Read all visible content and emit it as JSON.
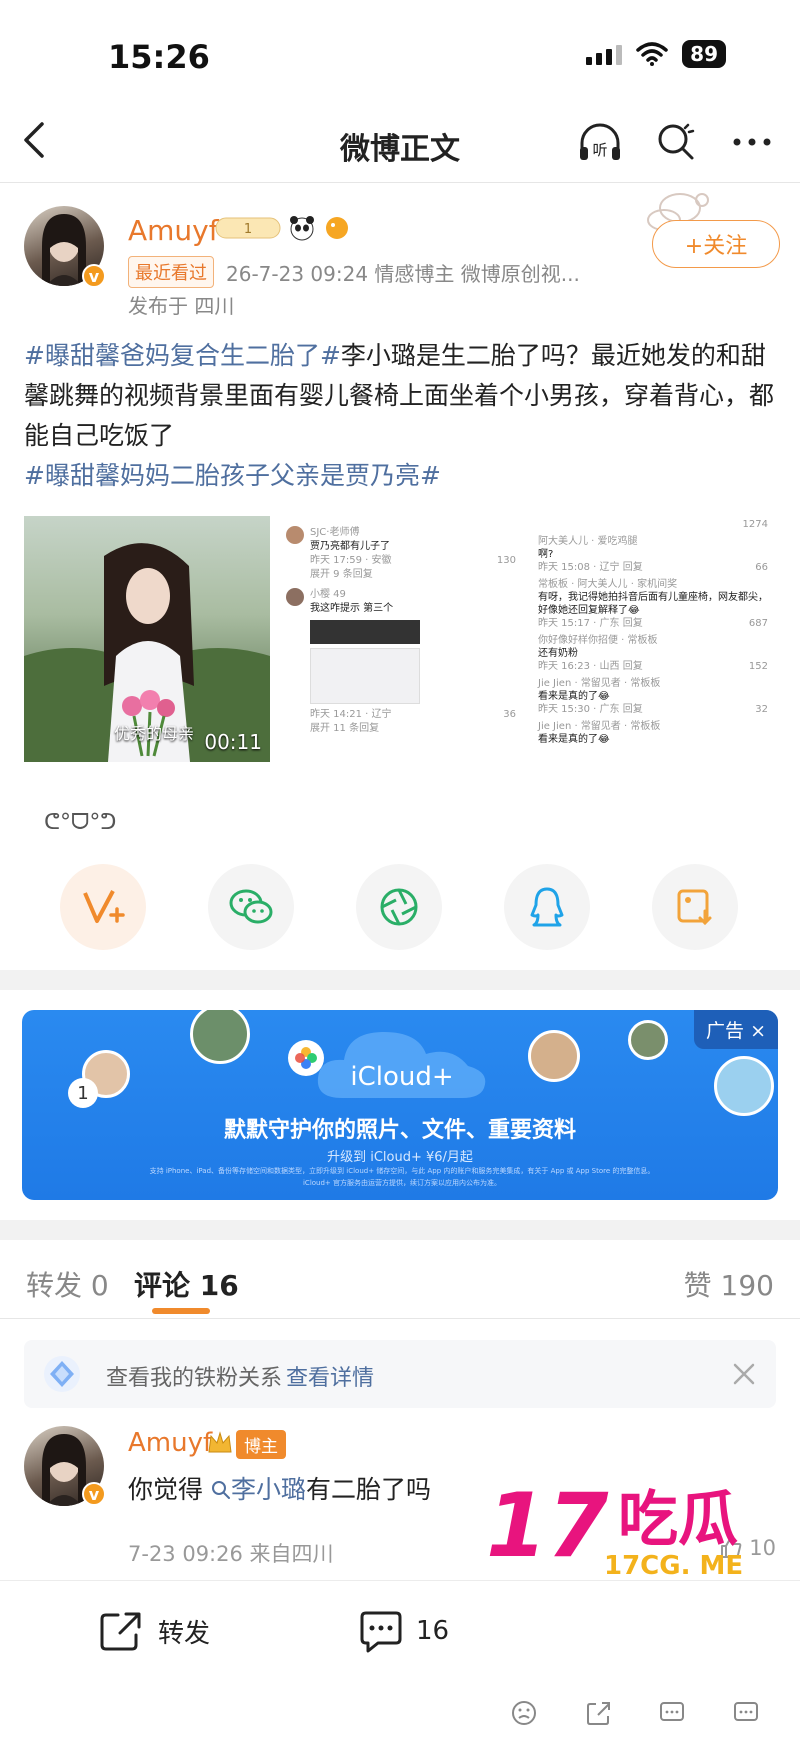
{
  "status_bar": {
    "time": "15:26",
    "battery": "89"
  },
  "nav": {
    "title": "微博正文"
  },
  "author": {
    "name": "Amuyf",
    "recent_tag": "最近看过",
    "meta": "26-7-23 09:24  情感博主  微博原创视...",
    "location": "发布于 四川",
    "follow_label": "+关注"
  },
  "post": {
    "topic1": "#曝甜馨爸妈复合生二胎了#",
    "body": "李小璐是生二胎了吗？最近她发的和甜馨跳舞的视频背景里面有婴儿餐椅上面坐着个小男孩，穿着背心，都能自己吃饭了",
    "topic2": "#曝甜馨妈妈二胎孩子父亲是贾乃亮#"
  },
  "media": {
    "video_caption": "优秀的母亲",
    "video_duration": "00:11",
    "shot1": {
      "rows": [
        {
          "user": "SJC·老师傅",
          "text": "贾乃亮都有儿子了",
          "meta": "昨天 17:59 · 安徽",
          "likes": "130"
        },
        {
          "user": "",
          "text": "展开 9 条回复",
          "meta": "",
          "likes": ""
        },
        {
          "user": "小樱 49",
          "text": "我这咋提示 第三个",
          "meta": "",
          "likes": ""
        },
        {
          "user": "",
          "text": "",
          "meta": "昨天 14:21 · 辽宁",
          "likes": "36"
        },
        {
          "user": "",
          "text": "展开 11 条回复",
          "meta": "",
          "likes": ""
        }
      ]
    },
    "shot2": {
      "rows": [
        {
          "user": "",
          "text": "",
          "meta": "",
          "likes": "1274"
        },
        {
          "user": "阿大美人儿 · 爱吃鸡腿",
          "text": "啊?",
          "meta": "昨天 15:08 · 辽宁  回复",
          "likes": "66"
        },
        {
          "user": "常板板 · 阿大美人儿 · 家机间奖",
          "text": "有呀，我记得她拍抖音后面有儿童座椅，网友都尖，好像她还回复解释了😂",
          "meta": "昨天 15:17 · 广东  回复",
          "likes": "687"
        },
        {
          "user": "你好像好样你招便 · 常板板",
          "text": "还有奶粉",
          "meta": "昨天 16:23 · 山西  回复",
          "likes": "152"
        },
        {
          "user": "Jie Jien · 常留见者 · 常板板",
          "text": "看来是真的了😂",
          "meta": "昨天 15:30 · 广东  回复",
          "likes": "32"
        },
        {
          "user": "Jie Jien · 常留见者 · 常板板",
          "text": "看来是真的了😂",
          "meta": "",
          "likes": ""
        }
      ]
    }
  },
  "emoticon": "ᕦ°ᗜ°ᕤ",
  "share_icons": [
    "v-plus-icon",
    "wechat-icon",
    "moments-icon",
    "qq-icon",
    "save-image-icon"
  ],
  "ad": {
    "tag": "广告 ×",
    "badge_count": "1",
    "product": "iCloud+",
    "headline": "默默守护你的照片、文件、重要资料",
    "subline": "升级到 iCloud+ ¥6/月起",
    "fine_print1": "支持 iPhone、iPad、备份等存储空间和数据类型，立即升级到 iCloud+ 储存空间，与此 App 内的账户和服务完美集成，有关于 App 或 App Store 的完整信息。",
    "fine_print2": "iCloud+ 官方服务由运营方提供，续订方案以应用内公布为准。"
  },
  "tabs": {
    "repost": "转发 0",
    "comment": "评论 16",
    "likes": "赞 190"
  },
  "fan_tip": {
    "text": "查看我的铁粉关系",
    "link": "查看详情"
  },
  "comment": {
    "name": "Amuyf",
    "badge": "博主",
    "text_prefix": "你觉得",
    "mention": "李小璐",
    "text_suffix": "有二胎了吗",
    "meta": "7-23 09:26 来自四川",
    "like_count": "10"
  },
  "bottom_bar": {
    "repost_label": "转发",
    "comment_count": "16"
  },
  "watermark": {
    "number": "17",
    "text": "吃瓜",
    "domain": "17CG. ME"
  },
  "colors": {
    "accent": "#f08a2c",
    "topic": "#4f6f9f",
    "ad_blue": "#1f7ae6",
    "watermark_pink": "#e8147e"
  }
}
